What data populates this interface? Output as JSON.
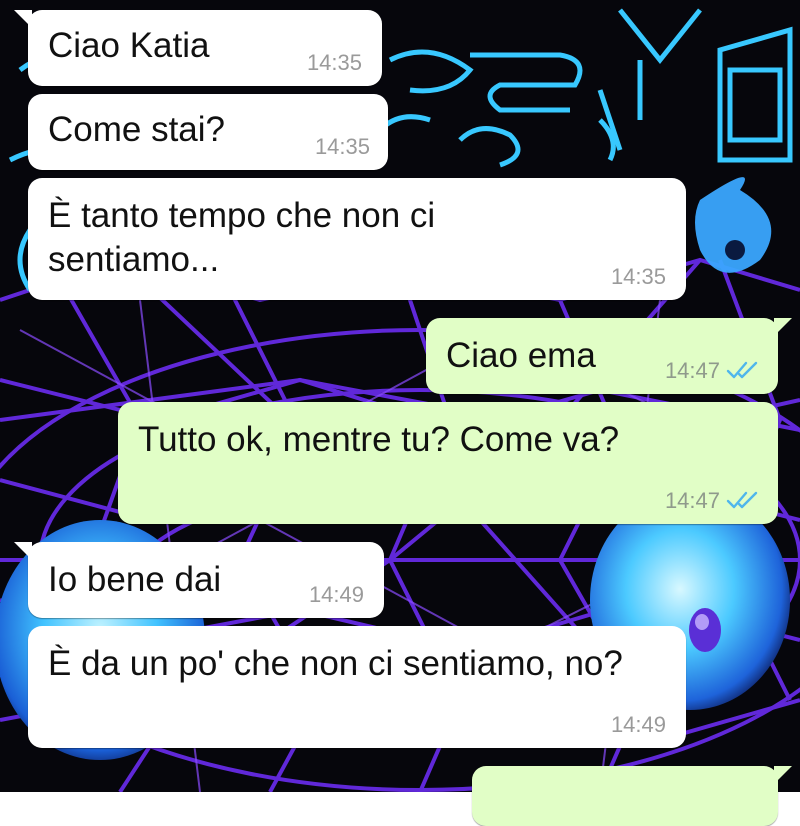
{
  "colors": {
    "incoming_bubble": "#ffffff",
    "outgoing_bubble": "#e1fec6",
    "read_ticks": "#4fb6ec",
    "wallpaper_purple": "#6a2cf0",
    "wallpaper_cyan": "#38c8ff"
  },
  "messages": [
    {
      "direction": "in",
      "text": "Ciao Katia",
      "time": "14:35"
    },
    {
      "direction": "in",
      "text": "Come stai?",
      "time": "14:35"
    },
    {
      "direction": "in",
      "text": "È tanto tempo che non ci\nsentiamo...",
      "time": "14:35"
    },
    {
      "direction": "out",
      "text": "Ciao ema",
      "time": "14:47",
      "status_icon": "double-check-read-icon"
    },
    {
      "direction": "out",
      "text": "Tutto ok, mentre tu? Come va?",
      "time": "14:47",
      "status_icon": "double-check-read-icon"
    },
    {
      "direction": "in",
      "text": "Io bene dai",
      "time": "14:49"
    },
    {
      "direction": "in",
      "text": "È da un po' che non ci sentiamo, no?",
      "time": "14:49"
    },
    {
      "direction": "out",
      "text": "",
      "time": "",
      "partial": true
    }
  ]
}
